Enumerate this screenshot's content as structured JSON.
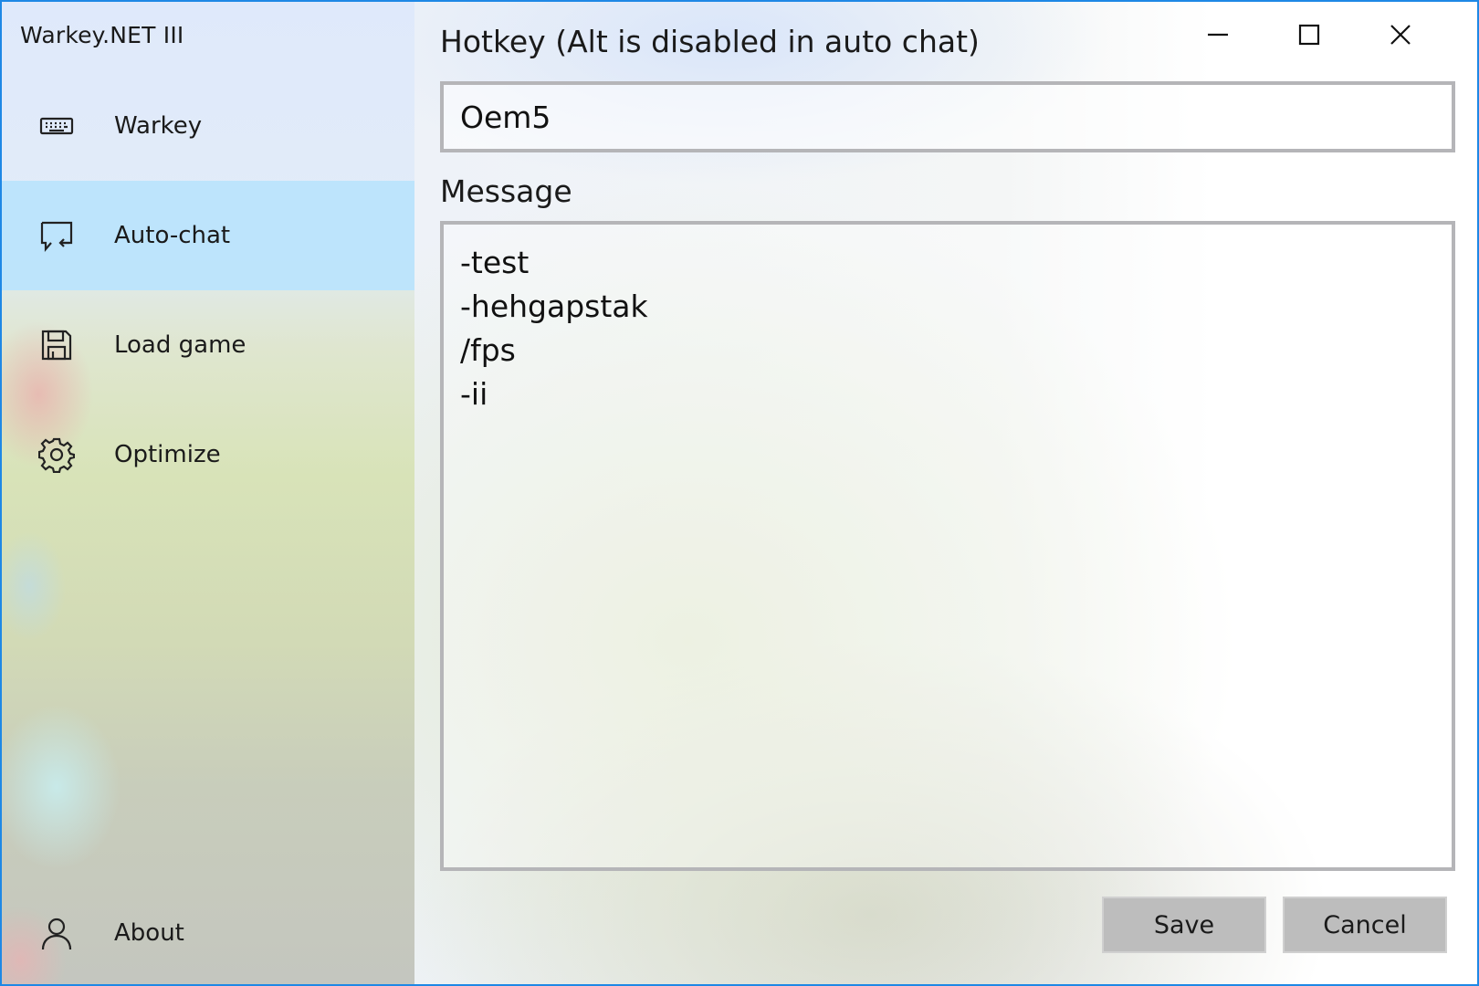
{
  "window": {
    "title": "Warkey.NET III"
  },
  "sidebar": {
    "items": [
      {
        "label": "Warkey",
        "icon": "keyboard-icon",
        "selected": false
      },
      {
        "label": "Auto-chat",
        "icon": "chat-icon",
        "selected": true
      },
      {
        "label": "Load game",
        "icon": "save-icon",
        "selected": false
      },
      {
        "label": "Optimize",
        "icon": "gear-icon",
        "selected": false
      },
      {
        "label": "About",
        "icon": "person-icon",
        "selected": false
      }
    ]
  },
  "main": {
    "hotkey_label": "Hotkey (Alt is disabled in auto chat)",
    "hotkey_value": "Oem5",
    "message_label": "Message",
    "message_lines": [
      "-test",
      "-hehgapstak",
      "/fps",
      "-ii"
    ],
    "save_label": "Save",
    "cancel_label": "Cancel"
  },
  "colors": {
    "accent_border": "#1e88e5",
    "selected_item": "#bae4fc",
    "button_bg": "#bdbdbd"
  }
}
